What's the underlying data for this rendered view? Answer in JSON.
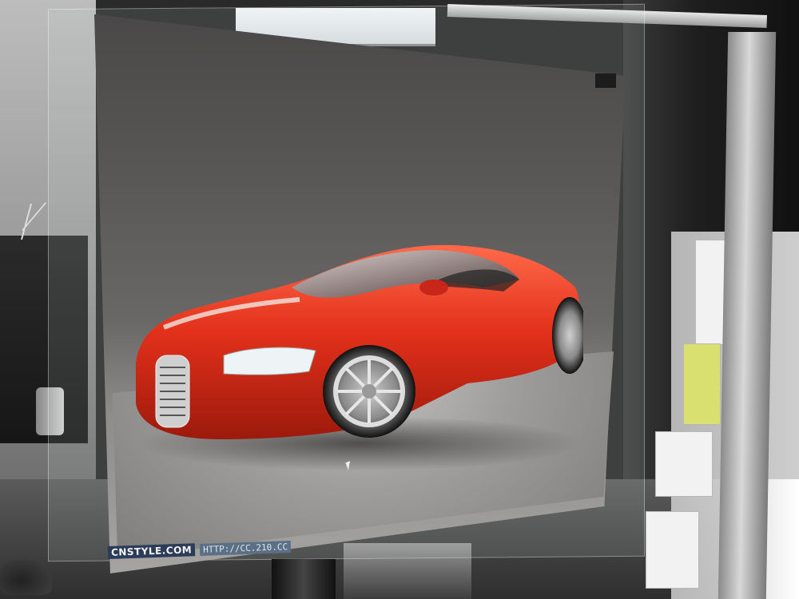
{
  "image": {
    "watermark_brand": "CNSTYLE.COM",
    "watermark_url": "HTTP://CC.210.CC"
  },
  "colors": {
    "car_red": "#e2301a",
    "car_highlight": "#ff6a4a",
    "screen_dark": "#4a4848",
    "wall": "#bdbdbd"
  }
}
